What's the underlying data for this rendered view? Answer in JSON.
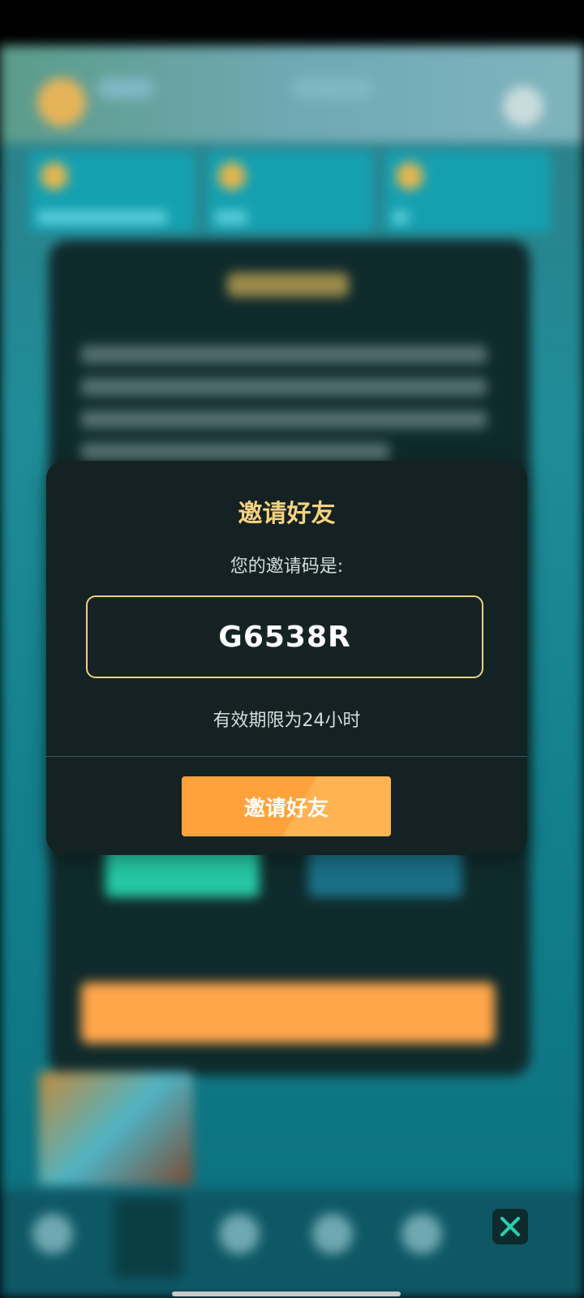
{
  "dialog": {
    "title": "邀请好友",
    "subtitle": "您的邀请码是:",
    "invite_code": "G6538R",
    "validity_text": "有效期限为24小时",
    "button_label": "邀请好友"
  },
  "colors": {
    "title": "#f5d27f",
    "code_border": "#f2d07f",
    "button": "#ffa23c",
    "dialog_bg": "#142223",
    "close_icon": "#23d3b0"
  },
  "icons": {
    "close": "close-icon"
  }
}
